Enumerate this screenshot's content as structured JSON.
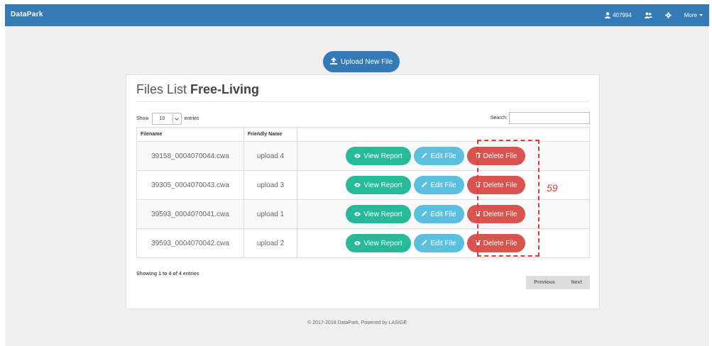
{
  "navbar": {
    "brand": "DataPark",
    "user_id": "407994",
    "user_icon": "user-icon",
    "group_icon": "users-icon",
    "settings_icon": "gear-icon",
    "more_label": "More"
  },
  "upload_button": {
    "label": "Upload New File",
    "icon": "upload-icon"
  },
  "panel": {
    "title_prefix": "Files List ",
    "title_strong": "Free-Living"
  },
  "length_control": {
    "show_label": "Show",
    "value": "10",
    "entries_label": "entries"
  },
  "search": {
    "label": "Search:",
    "value": ""
  },
  "table": {
    "headers": [
      "Filename",
      "Friendly Name",
      ""
    ],
    "rows": [
      {
        "filename": "39158_0004070044.cwa",
        "friendly": "upload 4"
      },
      {
        "filename": "39305_0004070043.cwa",
        "friendly": "upload 3"
      },
      {
        "filename": "39593_0004070041.cwa",
        "friendly": "upload 1"
      },
      {
        "filename": "39593_0004070042.cwa",
        "friendly": "upload 2"
      }
    ],
    "actions": {
      "view_label": "View Report",
      "edit_label": "Edit File",
      "delete_label": "Delete File"
    }
  },
  "annotation": {
    "number": "59",
    "color": "#e03c31"
  },
  "info": "Showing 1 to 4 of 4 entries",
  "pagination": {
    "previous": "Previous",
    "next": "Next"
  },
  "footer": "© 2017-2018 DataPark, Powered by LASIGE",
  "colors": {
    "navbar": "#337ab7",
    "view": "#26b99a",
    "edit": "#5bc0de",
    "delete": "#d9534f"
  }
}
